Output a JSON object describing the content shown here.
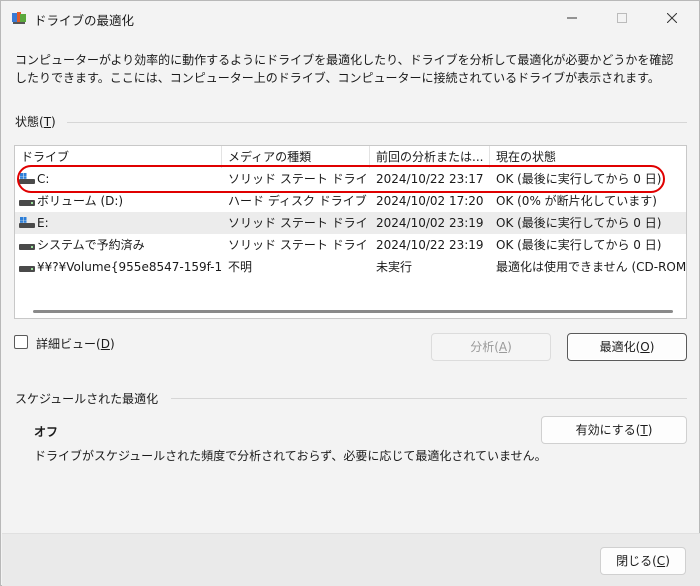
{
  "window": {
    "title": "ドライブの最適化",
    "minimize_glyph": "—",
    "maximize_glyph": "☐",
    "close_glyph": "✕"
  },
  "description": "コンピューターがより効率的に動作するようにドライブを最適化したり、ドライブを分析して最適化が必要かどうかを確認したりできます。ここには、コンピューター上のドライブ、コンピューターに接続されているドライブが表示されます。",
  "status_section": {
    "label": "状態(",
    "accel": "T",
    "label_end": ")"
  },
  "table": {
    "columns": [
      "ドライブ",
      "メディアの種類",
      "前回の分析または...",
      "現在の状態"
    ],
    "rows": [
      {
        "drive": "C:",
        "media": "ソリッド ステート ドライブ",
        "last": "2024/10/22 23:17",
        "status": "OK (最後に実行してから 0 日)",
        "icon": "windows-drive-icon"
      },
      {
        "drive": "ボリューム (D:)",
        "media": "ハード ディスク ドライブ",
        "last": "2024/10/02 17:20",
        "status": "OK (0% が断片化しています)",
        "icon": "drive-icon"
      },
      {
        "drive": "E:",
        "media": "ソリッド ステート ドライブ",
        "last": "2024/10/02 23:19",
        "status": "OK (最後に実行してから 0 日)",
        "icon": "windows-drive-icon"
      },
      {
        "drive": "システムで予約済み",
        "media": "ソリッド ステート ドライブ",
        "last": "2024/10/22 23:19",
        "status": "OK (最後に実行してから 0 日)",
        "icon": "drive-icon"
      },
      {
        "drive": "¥¥?¥Volume{955e8547-159f-1...",
        "media": "不明",
        "last": "未実行",
        "status": "最適化は使用できません (CD-ROM",
        "icon": "drive-icon"
      }
    ]
  },
  "advanced_view": {
    "label": "詳細ビュー(",
    "accel": "D",
    "label_end": ")",
    "checked": false
  },
  "buttons": {
    "analyze": {
      "label": "分析(",
      "accel": "A",
      "label_end": ")"
    },
    "optimize": {
      "label": "最適化(",
      "accel": "O",
      "label_end": ")"
    },
    "enable": {
      "label": "有効にする(",
      "accel": "T",
      "label_end": ")"
    },
    "close": {
      "label": "閉じる(",
      "accel": "C",
      "label_end": ")"
    }
  },
  "schedule": {
    "header": "スケジュールされた最適化",
    "status": "オフ",
    "description": "ドライブがスケジュールされた頻度で分析されておらず、必要に応じて最適化されていません。"
  },
  "colors": {
    "highlight": "#e00000",
    "accent": "#0067c0"
  }
}
